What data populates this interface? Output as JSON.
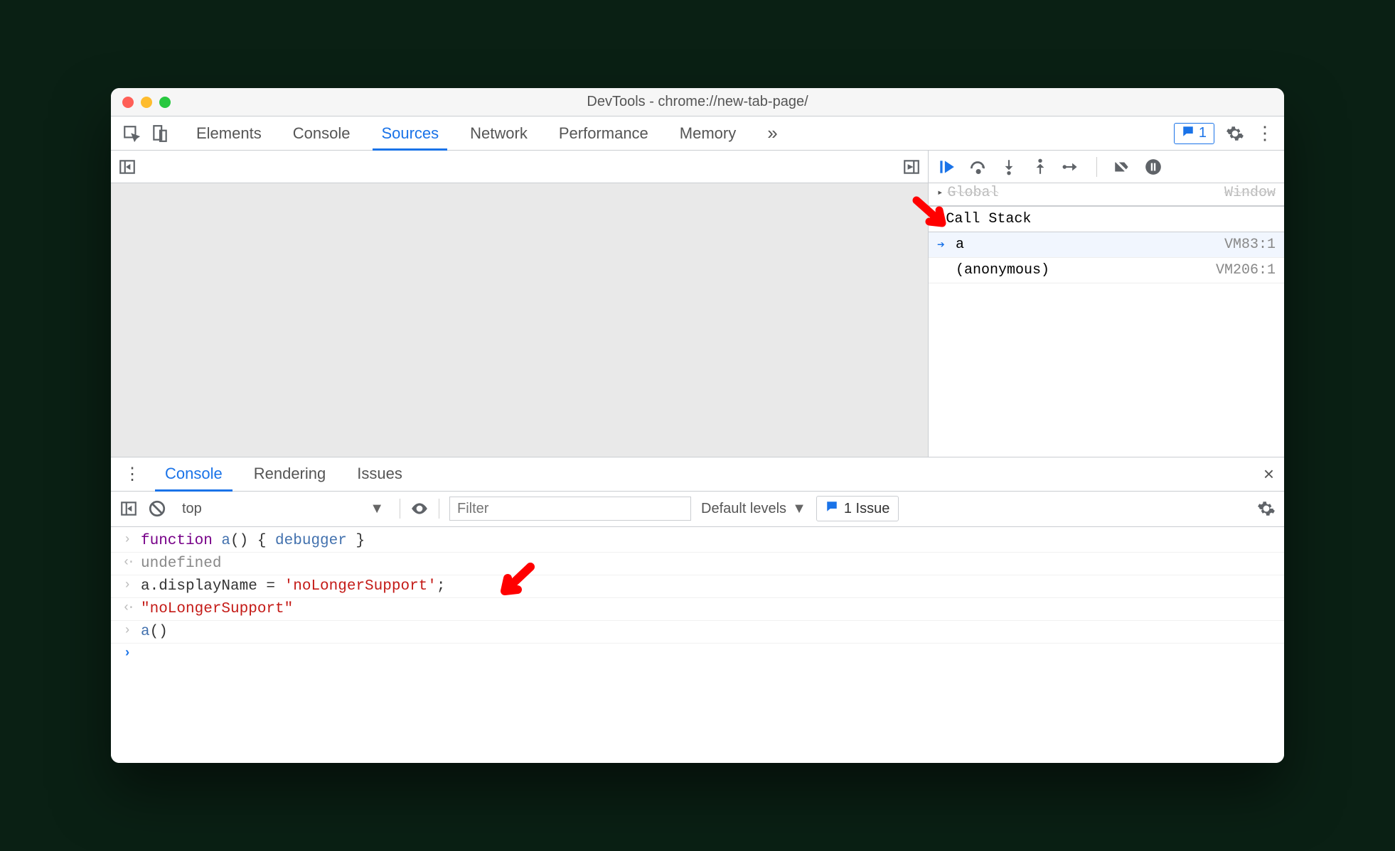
{
  "window_title": "DevTools - chrome://new-tab-page/",
  "main_tabs": [
    "Elements",
    "Console",
    "Sources",
    "Network",
    "Performance",
    "Memory"
  ],
  "main_tab_active": "Sources",
  "more_tabs_glyph": "»",
  "issue_badge_count": "1",
  "debugger": {
    "scope_peek_left": "Global",
    "scope_peek_right": "Window",
    "call_stack_label": "Call Stack",
    "frames": [
      {
        "name": "a",
        "loc": "VM83:1",
        "current": true
      },
      {
        "name": "(anonymous)",
        "loc": "VM206:1",
        "current": false
      }
    ]
  },
  "drawer": {
    "tabs": [
      "Console",
      "Rendering",
      "Issues"
    ],
    "active": "Console"
  },
  "console_toolbar": {
    "context": "top",
    "filter_placeholder": "Filter",
    "levels": "Default levels",
    "issue_pill": "1 Issue"
  },
  "console_lines": [
    {
      "type": "input",
      "tokens": [
        [
          "kw",
          "function "
        ],
        [
          "name",
          "a"
        ],
        [
          "plain",
          "() { "
        ],
        [
          "db",
          "debugger"
        ],
        [
          "plain",
          " }"
        ]
      ]
    },
    {
      "type": "output",
      "text": "undefined",
      "cls": "undef"
    },
    {
      "type": "input",
      "tokens": [
        [
          "plain",
          "a.displayName = "
        ],
        [
          "str",
          "'noLongerSupport'"
        ],
        [
          "plain",
          ";"
        ]
      ]
    },
    {
      "type": "output",
      "text": "\"noLongerSupport\"",
      "cls": "strout"
    },
    {
      "type": "input",
      "tokens": [
        [
          "name",
          "a"
        ],
        [
          "plain",
          "()"
        ]
      ]
    },
    {
      "type": "prompt"
    }
  ],
  "colors": {
    "accent": "#1a73e8",
    "annot": "#ff0000"
  }
}
